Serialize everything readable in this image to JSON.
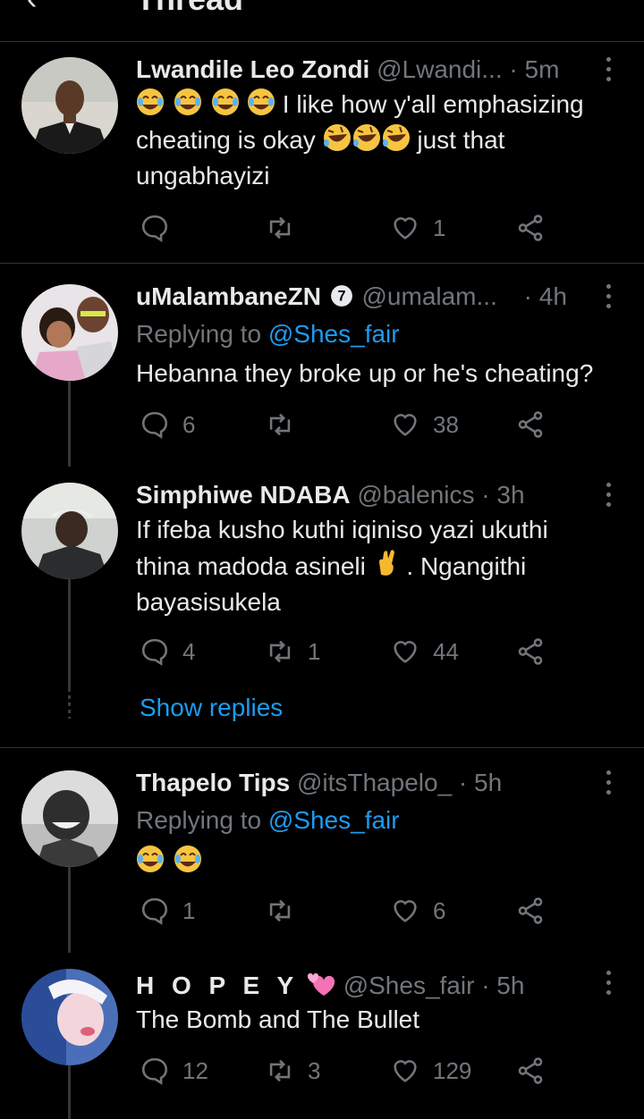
{
  "header": {
    "title": "Thread",
    "back_icon": "arrow-left-icon"
  },
  "tweets": [
    {
      "name": "Lwandile Leo Zondi",
      "handle": "@Lwandi...",
      "time": "· 5m",
      "body_after_emoji": "I like how y'all emphasizing",
      "body_line2_start": "cheating is okay",
      "body_line2_end": "just that",
      "body_line3": "ungabhayizi",
      "replies": "",
      "retweets": "",
      "likes": "1"
    },
    {
      "name": "uMalambaneZN",
      "handle": "@umalam...",
      "time": "· 4h",
      "replying_prefix": "Replying to",
      "replying_handle": "@Shes_fair",
      "body": "Hebanna they broke up or he's cheating?",
      "replies": "6",
      "retweets": "",
      "likes": "38"
    },
    {
      "name": "Simphiwe NDABA",
      "handle": "@balenics",
      "time": "· 3h",
      "body_line1": "If ifeba kusho kuthi iqiniso yazi  ukuthi",
      "body_line2_start": "thina madoda asineli",
      "body_line2_end": ".  Ngangithi",
      "body_line3": "bayasisukela",
      "replies": "4",
      "retweets": "1",
      "likes": "44",
      "show_replies": "Show replies"
    },
    {
      "name": "Thapelo Tips",
      "handle": "@itsThapelo_",
      "time": "· 5h",
      "replying_prefix": "Replying to",
      "replying_handle": "@Shes_fair",
      "replies": "1",
      "retweets": "",
      "likes": "6"
    },
    {
      "name": "H O P E Y",
      "handle": "@Shes_fair",
      "time": "· 5h",
      "body": "The Bomb and The Bullet",
      "replies": "12",
      "retweets": "3",
      "likes": "129"
    }
  ],
  "colors": {
    "background": "#000000",
    "text": "#e7e9ea",
    "muted": "#71767b",
    "link": "#1d9bf0",
    "divider": "#2f3336"
  }
}
